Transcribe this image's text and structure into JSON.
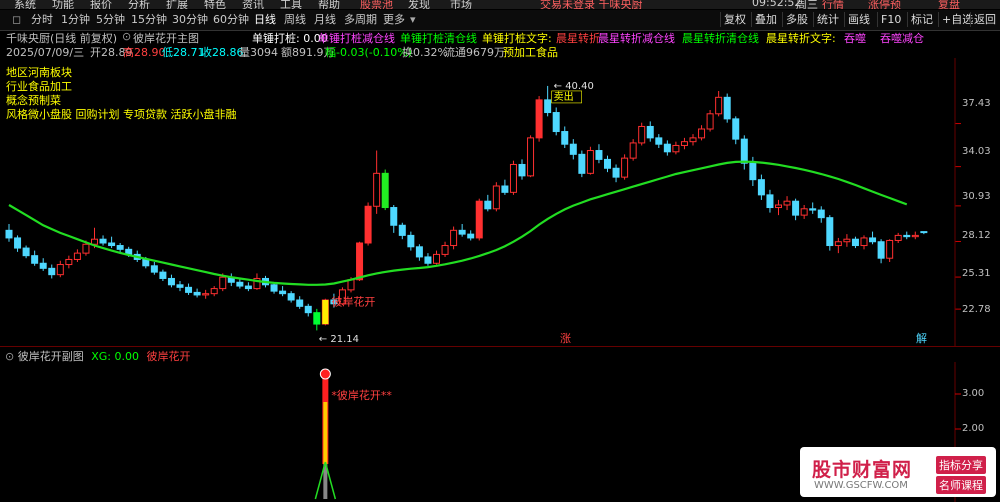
{
  "menu": [
    "系统",
    "功能",
    "报价",
    "分析",
    "扩展",
    "特色",
    "资讯",
    "工具",
    "帮助"
  ],
  "menu_center": [
    "股票池",
    "发现",
    "市场"
  ],
  "menu_notice": "交易未登录  千味央厨",
  "menu_time": "09:52:52",
  "menu_day": "周三",
  "menu_right": [
    "行情",
    "涨停预",
    "复盘"
  ],
  "periods": [
    "分时",
    "1分钟",
    "5分钟",
    "15分钟",
    "30分钟",
    "60分钟",
    "日线",
    "周线",
    "月线",
    "多周期",
    "更多"
  ],
  "active_period": "日线",
  "toolbar_right": [
    "复权",
    "叠加",
    "多股",
    "统计",
    "画线",
    "F10",
    "标记",
    "+自选",
    "返回"
  ],
  "main": {
    "title": "千味央厨(日线 前复权)",
    "indicator": "彼岸花开主图",
    "labels": [
      {
        "text": "单锤打桩: 0.00",
        "color": "#ffffff"
      },
      {
        "text": "单锤打桩减仓线",
        "color": "#ff44ff"
      },
      {
        "text": "单锤打桩清仓线",
        "color": "#00ff00"
      },
      {
        "text": "单锤打桩文字:",
        "color": "#ffff00"
      },
      {
        "text": "晨星转折",
        "color": "#ff4040"
      },
      {
        "text": "晨星转折减仓线",
        "color": "#ff44ff"
      },
      {
        "text": "晨星转折清仓线",
        "color": "#00ff00"
      },
      {
        "text": "晨星转折文字:",
        "color": "#ffff00"
      },
      {
        "text": "吞噬",
        "color": "#ff44ff"
      },
      {
        "text": "吞噬减仓",
        "color": "#ff44ff"
      }
    ],
    "quote": [
      {
        "text": "2025/07/09/三",
        "color": "#c0c0c0"
      },
      {
        "text": "开28.89",
        "color": "#c0c0c0"
      },
      {
        "text": "高28.90",
        "color": "#ff4040"
      },
      {
        "text": "低28.71",
        "color": "#00ffff"
      },
      {
        "text": "收28.86",
        "color": "#00ffff"
      },
      {
        "text": "量3094",
        "color": "#c0c0c0"
      },
      {
        "text": "额891.9万",
        "color": "#c0c0c0"
      },
      {
        "text": "幅-0.03(-0.10%)",
        "color": "#00ff00"
      },
      {
        "text": "换0.32%",
        "color": "#c0c0c0"
      },
      {
        "text": "流通9679万",
        "color": "#c0c0c0"
      },
      {
        "text": "预加工食品",
        "color": "#ffff00"
      }
    ],
    "tags": [
      "地区河南板块",
      "行业食品加工",
      "概念预制菜",
      "风格微小盘股 回购计划 专项贷款 活跃小盘非融"
    ],
    "high_label": "40.40",
    "sell_label": "卖出",
    "low_label": "21.14",
    "buy_label": "彼岸花开",
    "zhang_label": "涨",
    "jie_label": "解"
  },
  "y_axis": [
    "37.43",
    "34.03",
    "30.93",
    "28.12",
    "25.31",
    "22.78"
  ],
  "sub": {
    "title": "彼岸花开副图",
    "xg": "XG: 0.00",
    "name": "彼岸花开",
    "signal_label": "*彼岸花开**",
    "y_axis": [
      "3.00",
      "2.00"
    ]
  },
  "watermark": {
    "site": "股市财富网",
    "url": "WWW.GSCFW.COM",
    "tag1": "指标分享",
    "tag2": "名师课程"
  },
  "chart_data": {
    "type": "candlestick",
    "y_range": [
      20.5,
      41.5
    ],
    "ma_color": "#22dd22",
    "up_color": "#ff3030",
    "down_color": "#4fd8ff",
    "candles": [
      [
        29.0,
        29.5,
        28.1,
        28.4
      ],
      [
        28.4,
        28.6,
        27.3,
        27.6
      ],
      [
        27.6,
        27.8,
        26.8,
        27.0
      ],
      [
        27.0,
        27.4,
        26.2,
        26.4
      ],
      [
        26.4,
        26.8,
        25.8,
        26.0
      ],
      [
        26.0,
        26.3,
        25.2,
        25.5
      ],
      [
        25.5,
        26.6,
        25.3,
        26.3
      ],
      [
        26.3,
        27.0,
        26.0,
        26.7
      ],
      [
        26.7,
        27.5,
        26.5,
        27.2
      ],
      [
        27.2,
        28.2,
        27.0,
        27.9
      ],
      [
        27.9,
        29.2,
        27.6,
        28.3
      ],
      [
        28.3,
        28.6,
        27.8,
        28.0
      ],
      [
        28.0,
        28.5,
        27.6,
        27.8
      ],
      [
        27.8,
        28.0,
        27.2,
        27.5
      ],
      [
        27.5,
        27.7,
        26.9,
        27.1
      ],
      [
        27.1,
        27.4,
        26.5,
        26.7
      ],
      [
        26.7,
        26.9,
        26.0,
        26.2
      ],
      [
        26.2,
        26.5,
        25.5,
        25.7
      ],
      [
        25.7,
        25.9,
        25.0,
        25.2
      ],
      [
        25.2,
        25.5,
        24.5,
        24.7
      ],
      [
        24.7,
        25.0,
        24.2,
        24.5
      ],
      [
        24.5,
        24.8,
        23.9,
        24.1
      ],
      [
        24.1,
        24.4,
        23.7,
        23.9
      ],
      [
        23.9,
        24.3,
        23.6,
        24.0
      ],
      [
        24.0,
        24.6,
        23.8,
        24.4
      ],
      [
        24.4,
        25.6,
        24.2,
        25.3
      ],
      [
        25.3,
        25.6,
        24.6,
        24.9
      ],
      [
        24.9,
        25.2,
        24.4,
        24.6
      ],
      [
        24.6,
        24.9,
        24.2,
        24.4
      ],
      [
        24.4,
        25.6,
        24.3,
        25.2
      ],
      [
        25.2,
        25.4,
        24.5,
        24.7
      ],
      [
        24.7,
        24.9,
        24.0,
        24.2
      ],
      [
        24.2,
        24.6,
        23.8,
        24.0
      ],
      [
        24.0,
        24.2,
        23.3,
        23.5
      ],
      [
        23.5,
        23.8,
        22.8,
        23.0
      ],
      [
        23.0,
        23.2,
        22.2,
        22.5
      ],
      [
        22.5,
        22.8,
        21.1,
        21.6
      ],
      [
        21.6,
        23.6,
        21.5,
        23.5
      ],
      [
        23.5,
        24.0,
        22.9,
        23.2
      ],
      [
        23.2,
        24.5,
        23.1,
        24.3
      ],
      [
        24.3,
        25.3,
        24.1,
        25.1
      ],
      [
        25.1,
        28.1,
        25.0,
        28.0
      ],
      [
        28.0,
        31.2,
        27.8,
        30.9
      ],
      [
        30.9,
        35.3,
        30.3,
        33.5
      ],
      [
        33.5,
        33.8,
        30.6,
        30.8
      ],
      [
        30.8,
        31.0,
        28.8,
        29.4
      ],
      [
        29.4,
        29.6,
        28.3,
        28.6
      ],
      [
        28.6,
        28.9,
        27.4,
        27.7
      ],
      [
        27.7,
        27.9,
        26.6,
        26.9
      ],
      [
        26.9,
        27.2,
        26.2,
        26.4
      ],
      [
        26.4,
        27.4,
        26.3,
        27.1
      ],
      [
        27.1,
        28.1,
        26.9,
        27.8
      ],
      [
        27.8,
        29.3,
        27.5,
        29.0
      ],
      [
        29.0,
        29.5,
        28.5,
        28.7
      ],
      [
        28.7,
        29.0,
        28.2,
        28.4
      ],
      [
        28.4,
        31.5,
        28.2,
        31.3
      ],
      [
        31.3,
        31.8,
        30.5,
        30.7
      ],
      [
        30.7,
        32.8,
        30.5,
        32.5
      ],
      [
        32.5,
        33.0,
        31.8,
        32.0
      ],
      [
        32.0,
        34.5,
        31.8,
        34.2
      ],
      [
        34.2,
        34.6,
        33.0,
        33.3
      ],
      [
        33.3,
        36.5,
        33.2,
        36.3
      ],
      [
        36.3,
        39.6,
        36.0,
        39.3
      ],
      [
        39.3,
        40.4,
        38.0,
        38.3
      ],
      [
        38.3,
        38.7,
        36.5,
        36.8
      ],
      [
        36.8,
        37.2,
        35.5,
        35.8
      ],
      [
        35.8,
        36.2,
        34.6,
        35.0
      ],
      [
        35.0,
        35.3,
        33.2,
        33.5
      ],
      [
        33.5,
        35.6,
        33.4,
        35.3
      ],
      [
        35.3,
        35.8,
        34.3,
        34.6
      ],
      [
        34.6,
        34.9,
        33.6,
        33.9
      ],
      [
        33.9,
        34.2,
        32.8,
        33.2
      ],
      [
        33.2,
        35.0,
        33.0,
        34.7
      ],
      [
        34.7,
        36.2,
        34.5,
        35.9
      ],
      [
        35.9,
        37.5,
        35.7,
        37.2
      ],
      [
        37.2,
        37.6,
        36.0,
        36.3
      ],
      [
        36.3,
        36.6,
        35.5,
        35.8
      ],
      [
        35.8,
        36.1,
        34.9,
        35.2
      ],
      [
        35.2,
        36.0,
        35.0,
        35.7
      ],
      [
        35.7,
        36.3,
        35.4,
        36.0
      ],
      [
        36.0,
        36.6,
        35.7,
        36.3
      ],
      [
        36.3,
        37.3,
        36.1,
        37.0
      ],
      [
        37.0,
        38.5,
        36.8,
        38.2
      ],
      [
        38.2,
        40.0,
        38.0,
        39.5
      ],
      [
        39.5,
        39.8,
        37.5,
        37.8
      ],
      [
        37.8,
        38.0,
        35.8,
        36.2
      ],
      [
        36.2,
        36.5,
        33.8,
        34.3
      ],
      [
        34.3,
        34.8,
        32.5,
        33.0
      ],
      [
        33.0,
        33.4,
        31.4,
        31.8
      ],
      [
        31.8,
        32.2,
        30.4,
        30.8
      ],
      [
        30.8,
        31.4,
        30.2,
        31.0
      ],
      [
        31.0,
        31.7,
        30.6,
        31.3
      ],
      [
        31.3,
        31.5,
        29.8,
        30.2
      ],
      [
        30.2,
        31.0,
        29.9,
        30.7
      ],
      [
        30.7,
        31.2,
        30.3,
        30.6
      ],
      [
        30.6,
        30.9,
        29.6,
        30.0
      ],
      [
        30.0,
        30.2,
        27.4,
        27.8
      ],
      [
        27.8,
        28.4,
        27.2,
        28.1
      ],
      [
        28.1,
        28.7,
        27.7,
        28.3
      ],
      [
        28.3,
        28.5,
        27.6,
        27.8
      ],
      [
        27.8,
        28.6,
        27.5,
        28.4
      ],
      [
        28.4,
        28.9,
        27.9,
        28.1
      ],
      [
        28.1,
        28.3,
        26.4,
        26.8
      ],
      [
        26.8,
        28.3,
        26.5,
        28.2
      ],
      [
        28.2,
        28.8,
        28.0,
        28.6
      ],
      [
        28.6,
        28.9,
        28.3,
        28.5
      ],
      [
        28.5,
        28.9,
        28.3,
        28.6
      ],
      [
        28.9,
        28.9,
        28.7,
        28.86
      ]
    ],
    "ma": [
      31.0,
      30.6,
      30.2,
      29.8,
      29.4,
      29.1,
      28.8,
      28.55,
      28.3,
      28.05,
      27.8,
      27.6,
      27.4,
      27.22,
      27.05,
      26.9,
      26.75,
      26.6,
      26.45,
      26.3,
      26.15,
      26.0,
      25.85,
      25.7,
      25.55,
      25.42,
      25.3,
      25.2,
      25.1,
      25.0,
      24.92,
      24.85,
      24.8,
      24.76,
      24.73,
      24.7,
      24.7,
      24.72,
      24.8,
      24.95,
      25.1,
      25.28,
      25.45,
      25.6,
      25.72,
      25.82,
      25.9,
      25.97,
      26.03,
      26.1,
      26.2,
      26.32,
      26.45,
      26.6,
      26.78,
      26.98,
      27.2,
      27.45,
      27.75,
      28.1,
      28.5,
      28.95,
      29.45,
      29.9,
      30.3,
      30.65,
      30.95,
      31.2,
      31.45,
      31.65,
      31.85,
      32.05,
      32.25,
      32.45,
      32.65,
      32.85,
      33.05,
      33.25,
      33.45,
      33.6,
      33.75,
      33.9,
      34.05,
      34.2,
      34.32,
      34.4,
      34.42,
      34.4,
      34.35,
      34.27,
      34.17,
      34.05,
      33.92,
      33.78,
      33.62,
      33.45,
      33.26,
      33.05,
      32.82,
      32.58,
      32.32,
      32.06,
      31.8,
      31.55,
      31.3,
      31.05
    ],
    "signal_index": 37
  }
}
